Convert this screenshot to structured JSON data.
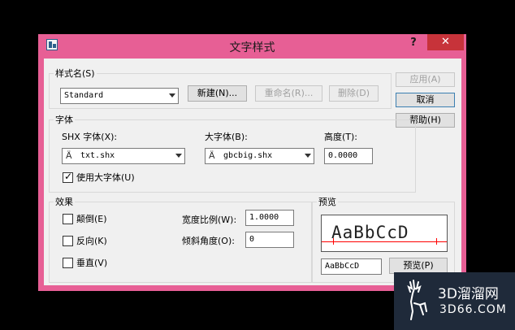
{
  "window": {
    "title": "文字样式",
    "help_label": "?",
    "close_label": "✕"
  },
  "style_group": {
    "label": "样式名(S)",
    "selected_style": "Standard",
    "new_button": "新建(N)...",
    "rename_button": "重命名(R)...",
    "delete_button": "删除(D)"
  },
  "side_buttons": {
    "apply": "应用(A)",
    "cancel": "取消",
    "help": "帮助(H)"
  },
  "font_group": {
    "label": "字体",
    "shx_label": "SHX 字体(X):",
    "shx_value": "txt.shx",
    "bigfont_label": "大字体(B):",
    "bigfont_value": "gbcbig.shx",
    "height_label": "高度(T):",
    "height_value": "0.0000",
    "use_bigfont_label": "使用大字体(U)",
    "use_bigfont_checked": true
  },
  "effects_group": {
    "label": "效果",
    "upside_down_label": "颠倒(E)",
    "backwards_label": "反向(K)",
    "vertical_label": "垂直(V)",
    "width_factor_label": "宽度比例(W):",
    "width_factor_value": "1.0000",
    "oblique_label": "倾斜角度(O):",
    "oblique_value": "0"
  },
  "preview_group": {
    "label": "预览",
    "sample_text": "AaBbCcD",
    "preview_input_value": "AaBbCcD",
    "preview_button": "预览(P)"
  },
  "watermark": {
    "main": "3D溜溜网",
    "sub": "3D66.COM"
  },
  "colors": {
    "titlebar": "#e75f95",
    "close": "#c7333a",
    "client": "#f0f0f0",
    "preview_baseline": "#ff0000"
  }
}
